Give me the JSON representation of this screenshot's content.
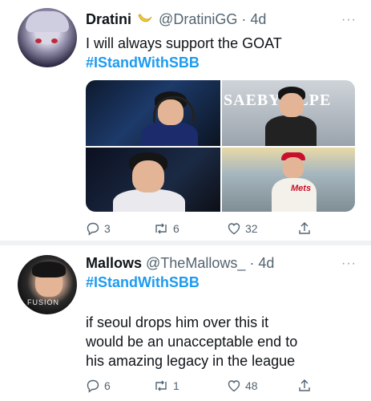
{
  "tweets": [
    {
      "name": "Dratini",
      "handle": "@DratiniGG",
      "time": "4d",
      "more": "···",
      "text": "I will always support the GOAT",
      "hashtag": "#IStandWithSBB",
      "media_text": {
        "banner": "SAEBY ULPE",
        "jersey": "Mets"
      },
      "replies": "3",
      "retweets": "6",
      "likes": "32"
    },
    {
      "name": "Mallows",
      "handle": "@TheMallows_",
      "time": "4d",
      "more": "···",
      "hashtag": "#IStandWithSBB",
      "body_lines": [
        "if seoul drops him over this it",
        "would be an unacceptable end to",
        "his amazing legacy in the league"
      ],
      "avatar_logo": "FUSION",
      "replies": "6",
      "retweets": "1",
      "likes": "48"
    }
  ],
  "colors": {
    "accent": "#1d9bf0",
    "muted": "#536471",
    "separator": "#eff3f4"
  },
  "icons": {
    "reply": "reply-icon",
    "retweet": "retweet-icon",
    "like": "heart-icon",
    "share": "share-icon",
    "badge": "banana-emoji-icon"
  }
}
